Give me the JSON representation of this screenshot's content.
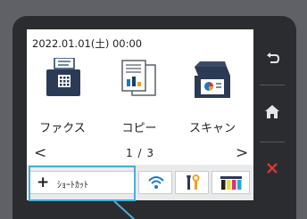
{
  "status": {
    "datetime": "2022.01.01(土)  00:00"
  },
  "apps": [
    {
      "label": "ファクス",
      "icon": "fax-icon"
    },
    {
      "label": "コピー",
      "icon": "copy-icon"
    },
    {
      "label": "スキャン",
      "icon": "scan-icon"
    }
  ],
  "pager": {
    "text": "1 / 3",
    "prev": "<",
    "next": ">"
  },
  "bottom_bar": {
    "shortcut_plus": "+",
    "shortcut_label": "ｼｮｰﾄｶｯﾄ",
    "wifi_icon": "wifi-icon",
    "tools_icon": "tools-icon",
    "ink_icon": "ink-icon"
  },
  "side_buttons": [
    "back-icon",
    "home-icon",
    "cancel-icon"
  ],
  "colors": {
    "callout": "#46b0d8",
    "cancel": "#d8353a",
    "wifi": "#1a78c8"
  }
}
